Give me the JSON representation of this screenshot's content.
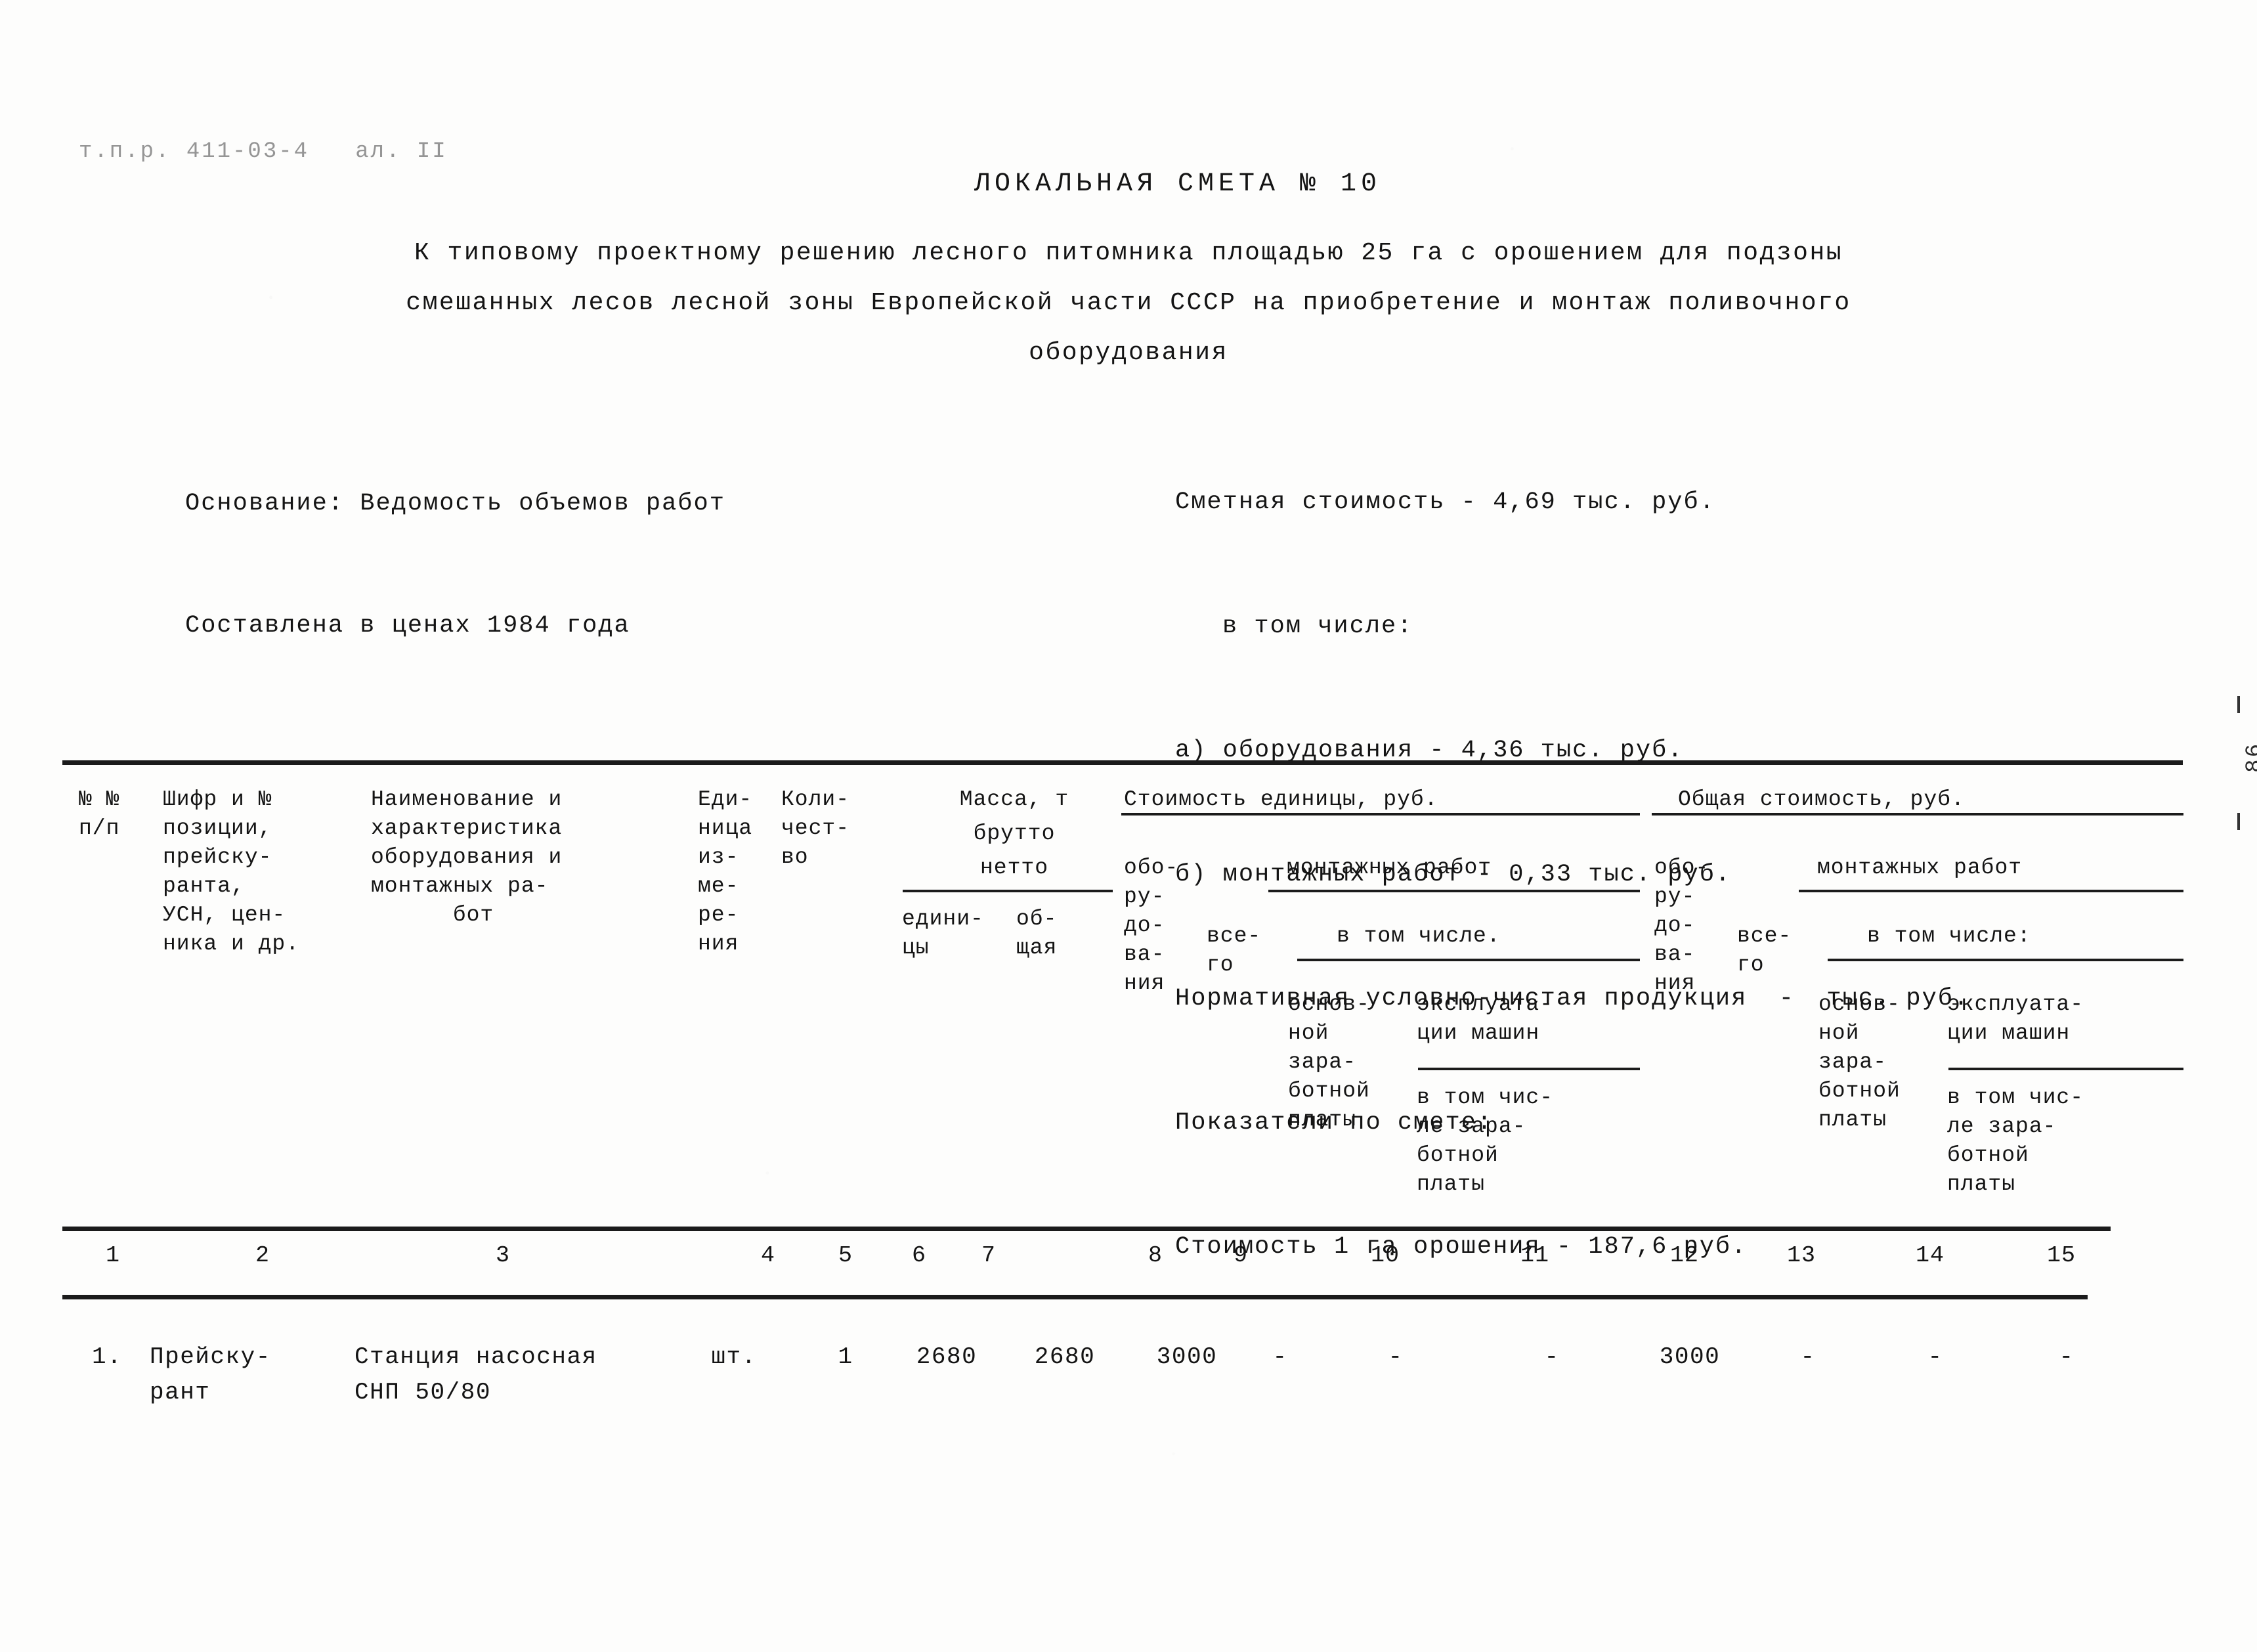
{
  "stamp": "т.п.р. 411-03-4   ал. II",
  "title": "ЛОКАЛЬНАЯ СМЕТА № 10",
  "subtitle": {
    "line1": "К типовому проектному решению лесного питомника площадью 25 га с орошением для подзоны",
    "line2": "смешанных лесов лесной зоны Европейской части СССР на приобретение и монтаж поливочного",
    "line3": "оборудования"
  },
  "info_left": {
    "basis": "Основание: Ведомость объемов работ",
    "prices": "Составлена в ценах 1984 года"
  },
  "info_right": {
    "total_cost": "Сметная стоимость - 4,69 тыс. руб.",
    "including": "в том числе:",
    "item_a": "а) оборудования - 4,36 тыс. руб.",
    "item_b": "б) монтажных работ - 0,33 тыс. руб.",
    "nucp": "Нормативная условно-чистая продукция  -  тыс. руб.",
    "indicators": "Показатели по смете:",
    "per_ha": "Стоимость 1 га орошения - 187,6 руб."
  },
  "page_number": "86",
  "table": {
    "headers": {
      "num": "№ №\nп/п",
      "code": "Шифр и №\nпозиции,\nпрейску-\nранта,\nУСН, цен-\nника и др.",
      "name": "Наименование и\nхарактеристика\nоборудования и\nмонтажных ра-\n      бот",
      "unit": "Еди-\nница\nиз-\nме-\nре-\nния",
      "qty": "Коли-\nчест-\nво",
      "mass_group": "Масса, т",
      "mass_gross": "брутто",
      "mass_net": "нетто",
      "mass_unit": "едини-\nцы",
      "mass_total": "об-\nщая",
      "unit_cost_group": "Стоимость единицы, руб.",
      "unit_equip": "обо-\nру-\nдо-\nва-\nния",
      "unit_install_group": "монтажных работ",
      "unit_install_total": "все-\nго",
      "unit_install_incl": "в том числе.",
      "unit_install_wages": "основ-\nной\nзара-\nботной\nплаты",
      "unit_install_machines": "эксплуата-\nции машин",
      "unit_install_machine_wages": "в том чис-\nле зара-\nботной\nплаты",
      "total_cost_group": "Общая стоимость, руб.",
      "total_equip": "обо-\nру-\nдо-\nва-\nния",
      "total_install_group": "монтажных работ",
      "total_install_total": "все-\nго",
      "total_install_incl": "в том числе:",
      "total_install_wages": "основ-\nной\nзара-\nботной\nплаты",
      "total_install_machines": "эксплуата-\nции машин",
      "total_install_machine_wages": "в том чис-\nле зара-\nботной\nплаты"
    },
    "column_numbers": [
      "1",
      "2",
      "3",
      "4",
      "5",
      "6",
      "7",
      "8",
      "9",
      "10",
      "11",
      "12",
      "13",
      "14",
      "15"
    ],
    "rows": [
      {
        "num": "1.",
        "code": "Прейску-\nрант",
        "name": "Станция насосная\nСНП 50/80",
        "unit": "шт.",
        "qty": "1",
        "mass_unit": "2680",
        "mass_total": "2680",
        "unit_equip": "3000",
        "unit_install_total": "-",
        "unit_install_wages": "-",
        "unit_install_machines": "-",
        "total_equip": "3000",
        "total_install_total": "-",
        "total_install_wages": "-",
        "total_install_machines": "-"
      }
    ]
  }
}
